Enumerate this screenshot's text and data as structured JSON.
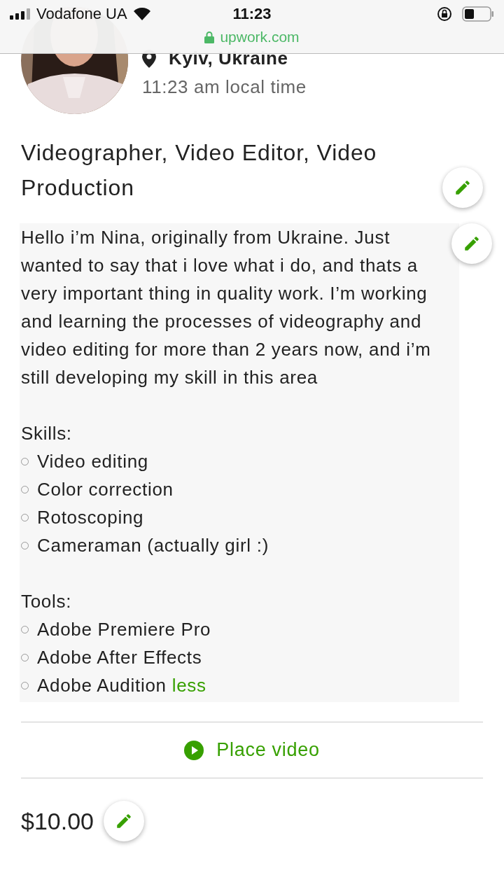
{
  "status_bar": {
    "carrier": "Vodafone UA",
    "time": "11:23"
  },
  "address_bar": {
    "url": "upwork.com",
    "secure": true
  },
  "profile": {
    "location": "Kyiv, Ukraine",
    "local_time": "11:23 am local time"
  },
  "title": "Videographer, Video Editor, Video Production",
  "overview": {
    "paragraph": "Hello i’m Nina, originally from Ukraine. Just wanted to say that i love what i do, and thats a very important thing in quality work. I’m working and learning the processes of videography and video editing for more than 2 years now, and i’m still developing my skill in this area",
    "skills_label": "Skills:",
    "skills": [
      "Video editing",
      "Color correction",
      "Rotoscoping",
      "Cameraman (actually girl :)"
    ],
    "tools_label": "Tools:",
    "tools": [
      "Adobe Premiere Pro",
      "Adobe After Effects",
      "Adobe Audition"
    ],
    "less_link": "less"
  },
  "video_button": "Place video",
  "rate": "$10.00"
}
